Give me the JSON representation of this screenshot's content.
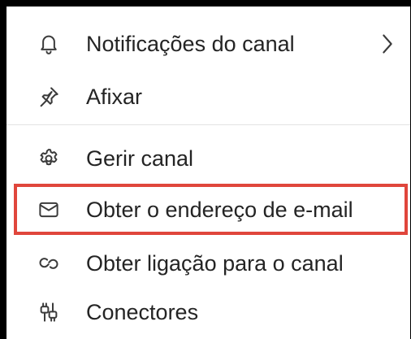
{
  "menu": {
    "items": [
      {
        "label": "Notificações do canal",
        "icon": "bell-icon",
        "has_submenu": true
      },
      {
        "label": "Afixar",
        "icon": "pin-icon",
        "has_submenu": false
      },
      {
        "label": "Gerir canal",
        "icon": "gear-icon",
        "has_submenu": false
      },
      {
        "label": "Obter o endereço de e-mail",
        "icon": "mail-icon",
        "has_submenu": false,
        "highlighted": true
      },
      {
        "label": "Obter ligação para o canal",
        "icon": "link-icon",
        "has_submenu": false
      },
      {
        "label": "Conectores",
        "icon": "connectors-icon",
        "has_submenu": false
      }
    ]
  },
  "colors": {
    "background_frame": "#000000",
    "menu_background": "#ffffff",
    "text": "#242424",
    "divider": "#e3e3e3",
    "highlight_border": "#e0463c"
  }
}
